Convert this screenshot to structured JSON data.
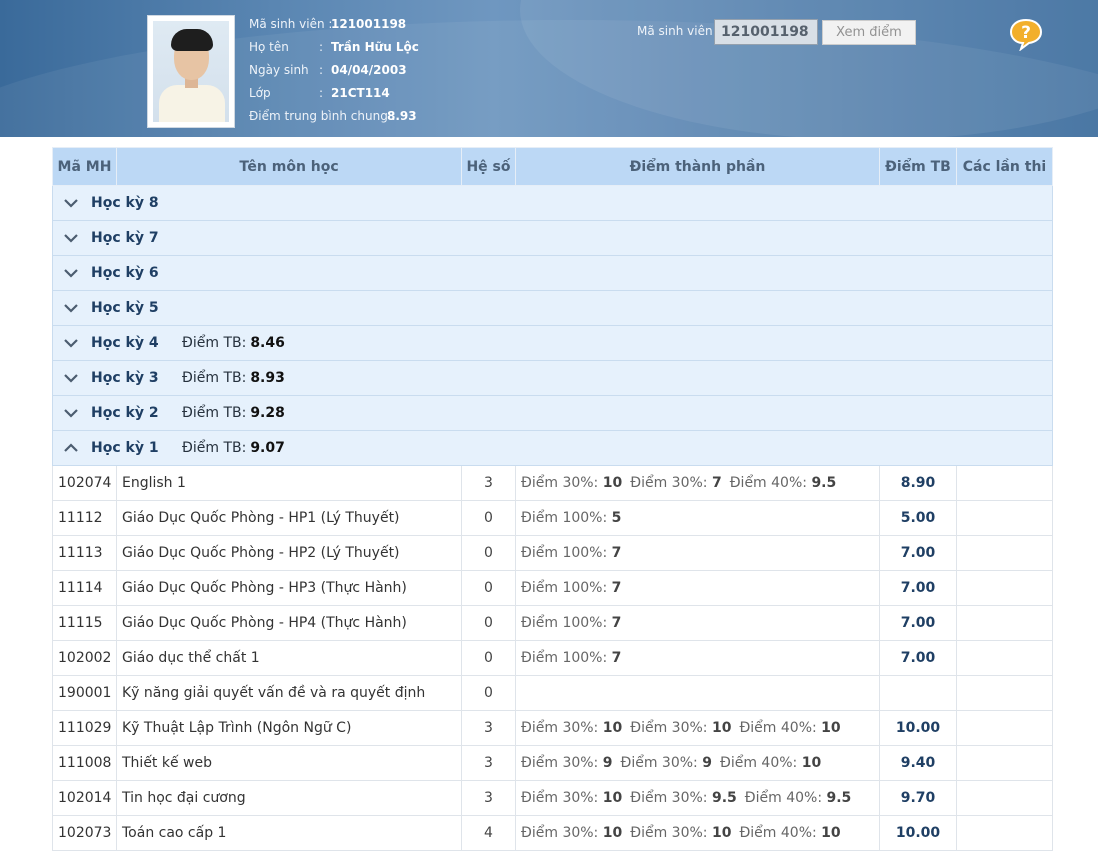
{
  "header": {
    "student": {
      "id_label": "Mã sinh viên :",
      "id_value": "121001198",
      "name_label": "Họ tên",
      "name_value": "Trần Hữu Lộc",
      "dob_label": "Ngày sinh",
      "dob_value": "04/04/2003",
      "class_label": "Lớp",
      "class_value": "21CT114",
      "gpa_label": "Điểm trung bình chung :",
      "gpa_value": "8.93"
    },
    "search": {
      "label": "Mã sinh viên",
      "value": "121001198",
      "button": "Xem điểm"
    },
    "help_icon": "help-question-icon"
  },
  "table": {
    "columns": [
      "Mã MH",
      "Tên môn học",
      "Hệ số",
      "Điểm thành phần",
      "Điểm TB",
      "Các lần thi"
    ],
    "avg_label": "Điểm TB:",
    "semesters": [
      {
        "label": "Học kỳ 8",
        "avg": "",
        "expanded": false
      },
      {
        "label": "Học kỳ 7",
        "avg": "",
        "expanded": false
      },
      {
        "label": "Học kỳ 6",
        "avg": "",
        "expanded": false
      },
      {
        "label": "Học kỳ 5",
        "avg": "",
        "expanded": false
      },
      {
        "label": "Học kỳ 4",
        "avg": "8.46",
        "expanded": false
      },
      {
        "label": "Học kỳ 3",
        "avg": "8.93",
        "expanded": false
      },
      {
        "label": "Học kỳ 2",
        "avg": "9.28",
        "expanded": false
      },
      {
        "label": "Học kỳ 1",
        "avg": "9.07",
        "expanded": true
      }
    ],
    "courses": [
      {
        "code": "102074",
        "name": "English 1",
        "coef": "3",
        "components": [
          {
            "label": "Điểm 30%:",
            "score": "10"
          },
          {
            "label": "Điểm 30%:",
            "score": "7"
          },
          {
            "label": "Điểm 40%:",
            "score": "9.5"
          }
        ],
        "avg": "8.90",
        "attempts": ""
      },
      {
        "code": "11112",
        "name": "Giáo Dục Quốc Phòng - HP1 (Lý Thuyết)",
        "coef": "0",
        "components": [
          {
            "label": "Điểm 100%:",
            "score": "5"
          }
        ],
        "avg": "5.00",
        "attempts": ""
      },
      {
        "code": "11113",
        "name": "Giáo Dục Quốc Phòng - HP2 (Lý Thuyết)",
        "coef": "0",
        "components": [
          {
            "label": "Điểm 100%:",
            "score": "7"
          }
        ],
        "avg": "7.00",
        "attempts": ""
      },
      {
        "code": "11114",
        "name": "Giáo Dục Quốc Phòng - HP3 (Thực Hành)",
        "coef": "0",
        "components": [
          {
            "label": "Điểm 100%:",
            "score": "7"
          }
        ],
        "avg": "7.00",
        "attempts": ""
      },
      {
        "code": "11115",
        "name": "Giáo Dục Quốc Phòng - HP4 (Thực Hành)",
        "coef": "0",
        "components": [
          {
            "label": "Điểm 100%:",
            "score": "7"
          }
        ],
        "avg": "7.00",
        "attempts": ""
      },
      {
        "code": "102002",
        "name": "Giáo dục thể chất 1",
        "coef": "0",
        "components": [
          {
            "label": "Điểm 100%:",
            "score": "7"
          }
        ],
        "avg": "7.00",
        "attempts": ""
      },
      {
        "code": "190001",
        "name": "Kỹ năng giải quyết vấn đề và ra quyết định",
        "coef": "0",
        "components": [],
        "avg": "",
        "attempts": ""
      },
      {
        "code": "111029",
        "name": "Kỹ Thuật Lập Trình (Ngôn Ngữ C)",
        "coef": "3",
        "components": [
          {
            "label": "Điểm 30%:",
            "score": "10"
          },
          {
            "label": "Điểm 30%:",
            "score": "10"
          },
          {
            "label": "Điểm 40%:",
            "score": "10"
          }
        ],
        "avg": "10.00",
        "attempts": ""
      },
      {
        "code": "111008",
        "name": "Thiết kế web",
        "coef": "3",
        "components": [
          {
            "label": "Điểm 30%:",
            "score": "9"
          },
          {
            "label": "Điểm 30%:",
            "score": "9"
          },
          {
            "label": "Điểm 40%:",
            "score": "10"
          }
        ],
        "avg": "9.40",
        "attempts": ""
      },
      {
        "code": "102014",
        "name": "Tin học đại cương",
        "coef": "3",
        "components": [
          {
            "label": "Điểm 30%:",
            "score": "10"
          },
          {
            "label": "Điểm 30%:",
            "score": "9.5"
          },
          {
            "label": "Điểm 40%:",
            "score": "9.5"
          }
        ],
        "avg": "9.70",
        "attempts": ""
      },
      {
        "code": "102073",
        "name": "Toán cao cấp 1",
        "coef": "4",
        "components": [
          {
            "label": "Điểm 30%:",
            "score": "10"
          },
          {
            "label": "Điểm 30%:",
            "score": "10"
          },
          {
            "label": "Điểm 40%:",
            "score": "10"
          }
        ],
        "avg": "10.00",
        "attempts": ""
      }
    ]
  },
  "colors": {
    "header_bg": "#4f7fae",
    "table_header_bg": "#bcd8f5",
    "semester_row_bg": "#e6f1fc",
    "accent_text": "#1f3f64"
  }
}
